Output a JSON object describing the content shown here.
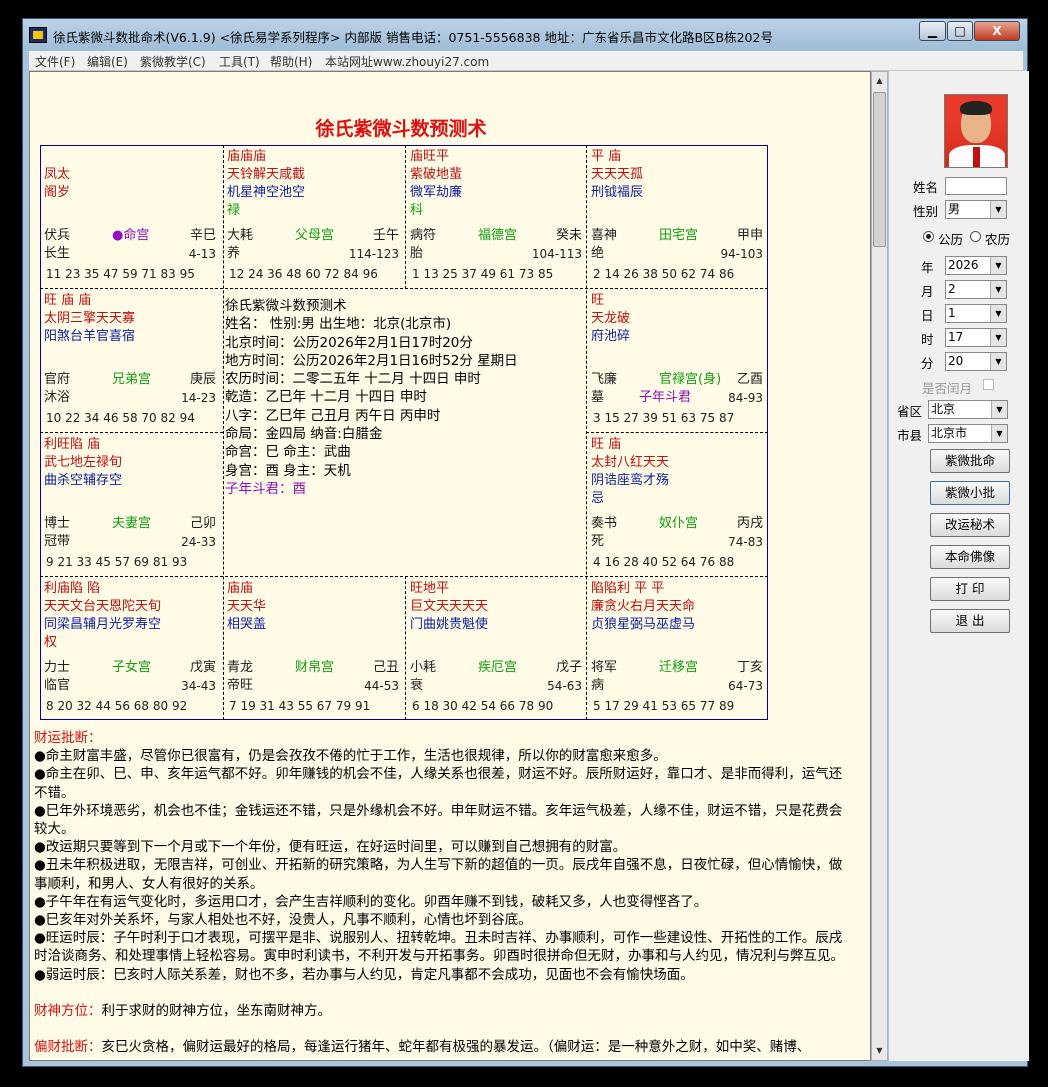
{
  "window": {
    "title": "徐氏紫微斗数批命术(V6.1.9)   <徐氏易学系列程序> 内部版  销售电话：0751-5556838  地址：广东省乐昌市文化路B区B栋202号",
    "min": "▁",
    "max": "□",
    "close": "X"
  },
  "menu": [
    "文件(F)",
    "编辑(E)",
    "紫微教学(C)",
    "工具(T)",
    "帮助(H)",
    "本站网址www.zhouyi27.com"
  ],
  "chart": {
    "title": "徐氏紫微斗数预测术",
    "palaces": [
      {
        "id": "p1",
        "lines": [
          {
            "t": "",
            "c": "c-red"
          },
          {
            "t": "凤太",
            "c": "c-red"
          },
          {
            "t": "阁岁",
            "c": "c-red"
          },
          {
            "t": "",
            "c": "c-red"
          }
        ],
        "l1": "伏兵",
        "name": "●命宫",
        "gz": "辛巳",
        "l2": "长生",
        "age": "4-13",
        "nums": "11  23  35  47  59  71  83  95",
        "namec": "c-purple"
      },
      {
        "id": "p2",
        "lines": [
          {
            "t": "庙庙庙",
            "c": "c-red"
          },
          {
            "t": "天铃解天咸截",
            "c": "c-red"
          },
          {
            "t": "机星神空池空",
            "c": "c-blue"
          },
          {
            "t": "禄",
            "c": "c-green"
          }
        ],
        "l1": "大耗",
        "name": "父母宫",
        "gz": "壬午",
        "l2": "养",
        "age": "114-123",
        "nums": "12  24  36  48  60  72  84  96",
        "namec": "c-green"
      },
      {
        "id": "p3",
        "lines": [
          {
            "t": "庙旺平",
            "c": "c-red"
          },
          {
            "t": "紫破地蜚",
            "c": "c-red"
          },
          {
            "t": "微军劫廉",
            "c": "c-blue"
          },
          {
            "t": "科",
            "c": "c-green"
          }
        ],
        "l1": "病符",
        "name": "福德宫",
        "gz": "癸未",
        "l2": "胎",
        "age": "104-113",
        "nums": "1  13  25  37  49  61  73  85",
        "namec": "c-green"
      },
      {
        "id": "p4",
        "lines": [
          {
            "t": "平  庙",
            "c": "c-red"
          },
          {
            "t": "天天天孤",
            "c": "c-red"
          },
          {
            "t": "刑钺福辰",
            "c": "c-blue"
          },
          {
            "t": "",
            "c": "c-red"
          }
        ],
        "l1": "喜神",
        "name": "田宅宫",
        "gz": "甲申",
        "l2": "绝",
        "age": "94-103",
        "nums": "2  14  26  38  50  62  74  86",
        "namec": "c-green"
      },
      {
        "id": "p5",
        "lines": [
          {
            "t": "旺   庙  庙",
            "c": "c-red"
          },
          {
            "t": "太阴三擎天天寡",
            "c": "c-red"
          },
          {
            "t": "阳煞台羊官喜宿",
            "c": "c-blue"
          },
          {
            "t": "",
            "c": "c-red"
          }
        ],
        "l1": "官府",
        "name": "兄弟宫",
        "gz": "庚辰",
        "l2": "沐浴",
        "age": "14-23",
        "nums": "10  22  34  46  58  70  82  94",
        "namec": "c-green"
      },
      {
        "id": "p6",
        "lines": [
          {
            "t": "旺",
            "c": "c-red"
          },
          {
            "t": "天龙破",
            "c": "c-red"
          },
          {
            "t": "府池碎",
            "c": "c-blue"
          },
          {
            "t": "",
            "c": "c-red"
          }
        ],
        "l1": "飞廉",
        "name": "官禄宫(身)",
        "gz": "乙酉",
        "l2": "墓",
        "age": "84-93",
        "nums": "3  15  27  39  51  63  75  87",
        "namec": "c-green",
        "extra": "子年斗君"
      },
      {
        "id": "p7",
        "lines": [
          {
            "t": "利旺陷  庙",
            "c": "c-red"
          },
          {
            "t": "武七地左禄旬",
            "c": "c-red"
          },
          {
            "t": "曲杀空辅存空",
            "c": "c-blue"
          },
          {
            "t": "",
            "c": "c-red"
          }
        ],
        "l1": "博士",
        "name": "夫妻宫",
        "gz": "己卯",
        "l2": "冠带",
        "age": "24-33",
        "nums": "9  21  33  45  57  69  81  93",
        "namec": "c-green"
      },
      {
        "id": "p8",
        "lines": [
          {
            "t": "旺    庙",
            "c": "c-red"
          },
          {
            "t": "太封八红天天",
            "c": "c-red"
          },
          {
            "t": "阴诰座鸾才殇",
            "c": "c-blue"
          },
          {
            "t": "忌",
            "c": "c-blue"
          }
        ],
        "l1": "奏书",
        "name": "奴仆宫",
        "gz": "丙戌",
        "l2": "死",
        "age": "74-83",
        "nums": "4  16  28  40  52  64  76  88",
        "namec": "c-green"
      },
      {
        "id": "p9",
        "lines": [
          {
            "t": "利庙陷     陷",
            "c": "c-red"
          },
          {
            "t": "天天文台天恩陀天旬",
            "c": "c-red"
          },
          {
            "t": "同梁昌辅月光罗寿空",
            "c": "c-blue"
          },
          {
            "t": "  权",
            "c": "c-red"
          }
        ],
        "l1": "力士",
        "name": "子女宫",
        "gz": "戊寅",
        "l2": "临官",
        "age": "34-43",
        "nums": "8  20  32  44  56  68  80  92",
        "namec": "c-green"
      },
      {
        "id": "p10",
        "lines": [
          {
            "t": "庙庙",
            "c": "c-red"
          },
          {
            "t": "天天华",
            "c": "c-red"
          },
          {
            "t": "相哭盖",
            "c": "c-blue"
          },
          {
            "t": "",
            "c": "c-red"
          }
        ],
        "l1": "青龙",
        "name": "财帛宫",
        "gz": "己丑",
        "l2": "帝旺",
        "age": "44-53",
        "nums": "7  19  31  43  55  67  79  91",
        "namec": "c-green"
      },
      {
        "id": "p11",
        "lines": [
          {
            "t": "旺地平",
            "c": "c-red"
          },
          {
            "t": "巨文天天天天",
            "c": "c-red"
          },
          {
            "t": "门曲姚贵魁使",
            "c": "c-blue"
          },
          {
            "t": "",
            "c": "c-red"
          }
        ],
        "l1": "小耗",
        "name": "疾厄宫",
        "gz": "戊子",
        "l2": "衰",
        "age": "54-63",
        "nums": "6  18  30  42  54  66  78  90",
        "namec": "c-green"
      },
      {
        "id": "p12",
        "lines": [
          {
            "t": "陷陷利   平    平",
            "c": "c-red"
          },
          {
            "t": "廉贪火右月天天命",
            "c": "c-red"
          },
          {
            "t": "贞狼星弼马巫虚马",
            "c": "c-blue"
          },
          {
            "t": "",
            "c": "c-red"
          }
        ],
        "l1": "将军",
        "name": "迁移宫",
        "gz": "丁亥",
        "l2": "病",
        "age": "64-73",
        "nums": "5  17  29  41  53  65  77  89",
        "namec": "c-green"
      }
    ],
    "center": [
      "徐氏紫微斗数预测术",
      "姓名：  性别:男   出生地：北京(北京市)",
      "北京时间：公历2026年2月1日17时20分",
      "地方时间：公历2026年2月1日16时52分  星期日",
      "农历时间：二零二五年 十二月 十四日 申时",
      "乾造：乙巳年 十二月 十四日  申时",
      "八字：乙巳年  己丑月  丙午日  丙申时",
      "命局：金四局   纳音:白腊金",
      "命宫：巳    命主：武曲",
      "身宫：酉    身主：天机",
      "子年斗君：酉"
    ]
  },
  "report": {
    "wealth_head": "财运批断：",
    "wealth": [
      "●命主财富丰盛，尽管你已很富有，仍是会孜孜不倦的忙于工作，生活也很规律，所以你的财富愈来愈多。",
      "●命主在卯、巳、申、亥年运气都不好。卯年赚钱的机会不佳，人缘关系也很差，财运不好。辰所财运好，靠口才、是非而得利，运气还不错。",
      "●巳年外环境恶劣，机会也不佳；金钱运还不错，只是外缘机会不好。申年财运不错。亥年运气极差，人缘不佳，财运不错，只是花费会较大。",
      "●改运期只要等到下一个月或下一个年份，便有旺运，在好运时间里，可以赚到自己想拥有的财富。",
      "●丑未年积极进取，无限吉祥，可创业、开拓新的研究策略，为人生写下新的超值的一页。辰戌年自强不息，日夜忙碌，但心情愉快，做事顺利，和男人、女人有很好的关系。",
      "●子午年在有运气变化时，多运用口才，会产生吉祥顺利的变化。卯酉年赚不到钱，破耗又多，人也变得悭吝了。",
      "●巳亥年对外关系坏，与家人相处也不好，没贵人，凡事不顺利，心情也坏到谷底。",
      "●旺运时辰：子午时利于口才表现，可摆平是非、说服别人、扭转乾坤。丑未时吉祥、办事顺利，可作一些建设性、开拓性的工作。辰戌时洽谈商务、和处理事情上轻松容易。寅申时利读书，不利开发与开拓事务。卯酉时很拼命但无财，办事和与人约见，情况利与弊互见。",
      "●弱运时辰：巳亥时人际关系差，财也不多，若办事与人约见，肯定凡事都不会成功，见面也不会有愉快场面。"
    ],
    "god_head": "财神方位：",
    "god": "利于求财的财神方位，坐东南财神方。",
    "partial_head": "偏财批断：",
    "partial": "亥巳火贪格，偏财运最好的格局，每逢运行猪年、蛇年都有极强的暴发运。（偏财运：是一种意外之财，如中奖、赌博、"
  },
  "side": {
    "name_label": "姓名",
    "name_value": "",
    "gender_label": "性别",
    "gender_value": "男",
    "cal_solar": "公历",
    "cal_lunar": "农历",
    "year_label": "年",
    "year_value": "2026",
    "month_label": "月",
    "month_value": "2",
    "day_label": "日",
    "day_value": "1",
    "hour_label": "时",
    "hour_value": "17",
    "min_label": "分",
    "min_value": "20",
    "leap_label": "是否闰月",
    "province_label": "省区",
    "province_value": "北京",
    "city_label": "市县",
    "city_value": "北京市",
    "buttons": [
      "紫微批命",
      "紫微小批",
      "改运秘术",
      "本命佛像",
      "打 印",
      "退 出"
    ]
  },
  "colors": {
    "title_red": "#dd1111",
    "palace_red": "#c01010",
    "palace_blue": "#1020a0",
    "palace_green": "#10a010",
    "bg_paper": "#fffbe6"
  }
}
